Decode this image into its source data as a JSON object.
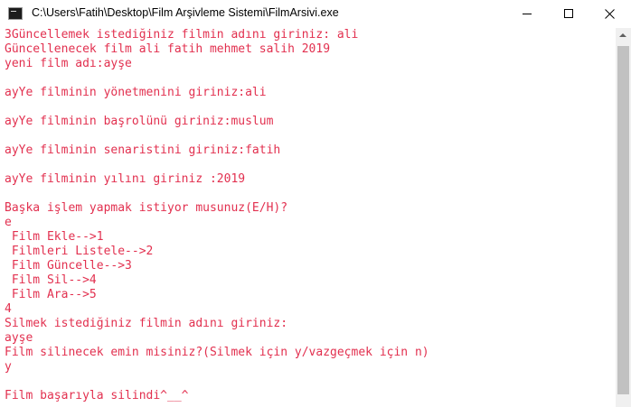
{
  "window": {
    "title": "C:\\Users\\Fatih\\Desktop\\Film Arşivleme Sistemi\\FilmArsivi.exe",
    "icon": "console-app-icon"
  },
  "colors": {
    "console_text": "#e2304f",
    "background": "#ffffff"
  },
  "console": {
    "lines": [
      "3Güncellemek istediğiniz filmin adını giriniz: ali",
      "Güncellenecek film ali fatih mehmet salih 2019",
      "yeni film adı:ayşe",
      "",
      "ayYe filminin yönetmenini giriniz:ali",
      "",
      "ayYe filminin başrolünü giriniz:muslum",
      "",
      "ayYe filminin senaristini giriniz:fatih",
      "",
      "ayYe filminin yılını giriniz :2019",
      "",
      "Başka işlem yapmak istiyor musunuz(E/H)?",
      "e",
      " Film Ekle-->1",
      " Filmleri Listele-->2",
      " Film Güncelle-->3",
      " Film Sil-->4",
      " Film Ara-->5",
      "4",
      "Silmek istediğiniz filmin adını giriniz:",
      "ayşe",
      "Film silinecek emin misiniz?(Silmek için y/vazgeçmek için n)",
      "y",
      "",
      "Film başarıyla silindi^__^"
    ]
  }
}
